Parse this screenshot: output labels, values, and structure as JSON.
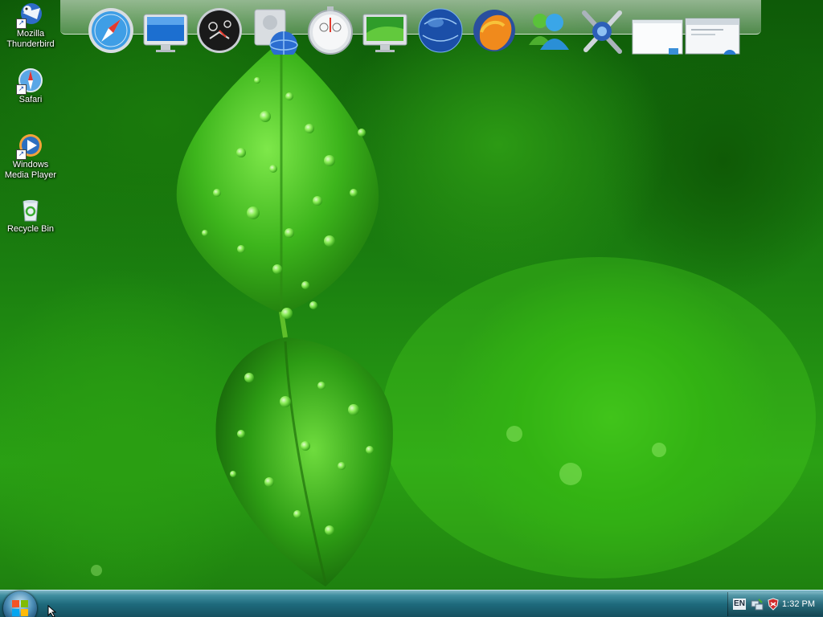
{
  "desktop_icons": [
    {
      "label": "Mozilla Thunderbird",
      "icon": "thunderbird-icon"
    },
    {
      "label": "Safari",
      "icon": "safari-icon"
    },
    {
      "label": "Windows Media Player",
      "icon": "media-player-icon"
    },
    {
      "label": "Recycle Bin",
      "icon": "recycle-bin-icon"
    }
  ],
  "dock": {
    "items": [
      {
        "icon": "safari-compass-icon"
      },
      {
        "icon": "imac-monitor-icon"
      },
      {
        "icon": "dashboard-gauge-icon"
      },
      {
        "icon": "network-drive-icon"
      },
      {
        "icon": "stopwatch-icon"
      },
      {
        "icon": "desktop-display-icon"
      },
      {
        "icon": "blue-globe-icon"
      },
      {
        "icon": "firefox-icon"
      },
      {
        "icon": "messenger-buddies-icon"
      },
      {
        "icon": "tools-wrench-icon"
      },
      {
        "icon": "window-thumbnail-icon"
      },
      {
        "icon": "window-thumbnail-icon"
      }
    ]
  },
  "taskbar": {
    "language": "EN",
    "clock": "1:32 PM"
  }
}
